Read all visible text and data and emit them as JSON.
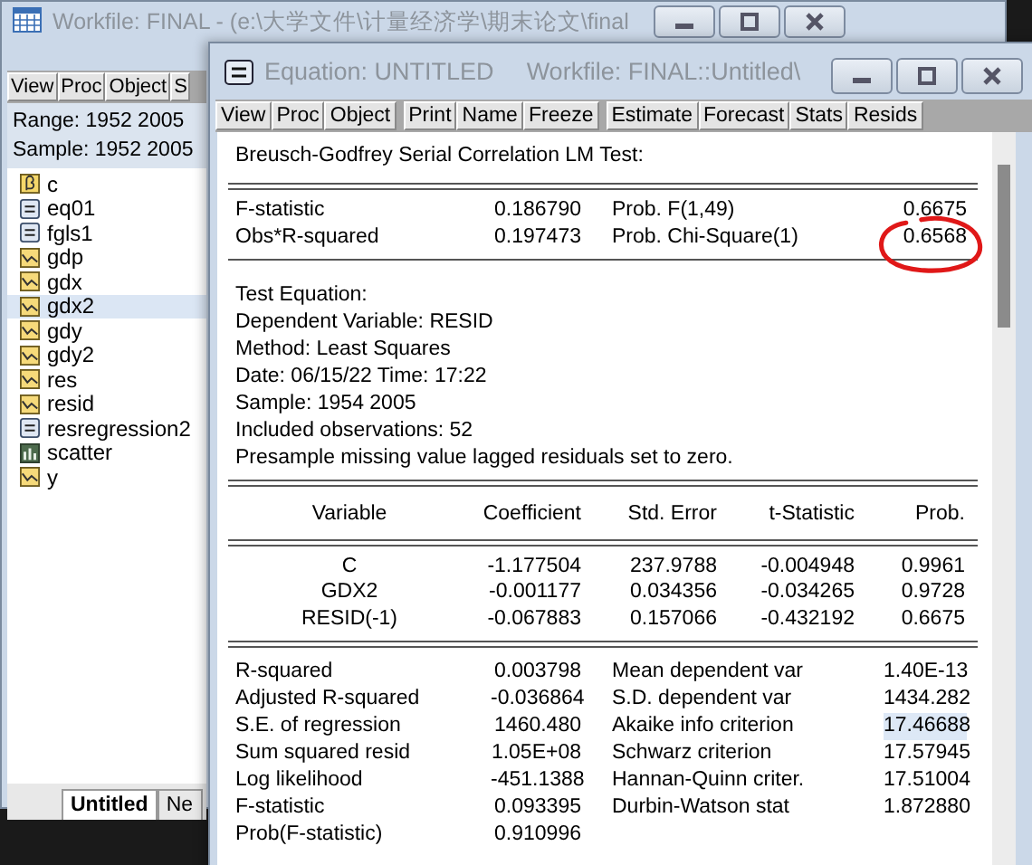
{
  "back_window": {
    "title": "Workfile: FINAL - (e:\\大学文件\\计量经济学\\期末论文\\final",
    "toolbar": [
      "View",
      "Proc",
      "Object",
      "S"
    ],
    "range": "Range:  1952 2005",
    "sample": "Sample: 1952 2005",
    "objects": [
      {
        "name": "c",
        "kind": "coef",
        "selected": false
      },
      {
        "name": "eq01",
        "kind": "equation",
        "selected": false
      },
      {
        "name": "fgls1",
        "kind": "equation",
        "selected": false
      },
      {
        "name": "gdp",
        "kind": "series",
        "selected": false
      },
      {
        "name": "gdx",
        "kind": "series",
        "selected": false
      },
      {
        "name": "gdx2",
        "kind": "series",
        "selected": true
      },
      {
        "name": "gdy",
        "kind": "series",
        "selected": false
      },
      {
        "name": "gdy2",
        "kind": "series",
        "selected": false
      },
      {
        "name": "res",
        "kind": "series",
        "selected": false
      },
      {
        "name": "resid",
        "kind": "series",
        "selected": false
      },
      {
        "name": "resregression2",
        "kind": "equation",
        "selected": false
      },
      {
        "name": "scatter",
        "kind": "graph",
        "selected": false
      },
      {
        "name": "y",
        "kind": "series",
        "selected": false
      }
    ],
    "tabs": [
      {
        "label": "Untitled",
        "selected": true
      },
      {
        "label": "Ne",
        "selected": false
      }
    ]
  },
  "front_window": {
    "title": "Equation: UNTITLED",
    "subtitle": "Workfile: FINAL::Untitled\\",
    "toolbar": [
      "View",
      "Proc",
      "Object",
      "Print",
      "Name",
      "Freeze",
      "Estimate",
      "Forecast",
      "Stats",
      "Resids"
    ],
    "heading": "Breusch-Godfrey Serial Correlation LM Test:",
    "test_stats": [
      {
        "label": "F-statistic",
        "value": "0.186790",
        "prob_label": "Prob. F(1,49)",
        "prob_value": "0.6675",
        "circled": false
      },
      {
        "label": "Obs*R-squared",
        "value": "0.197473",
        "prob_label": "Prob. Chi-Square(1)",
        "prob_value": "0.6568",
        "circled": true
      }
    ],
    "test_equation": [
      "Test Equation:",
      "Dependent Variable: RESID",
      "Method: Least Squares",
      "Date: 06/15/22   Time: 17:22",
      "Sample: 1954 2005",
      "Included observations: 52",
      "Presample missing value lagged residuals set to zero."
    ],
    "coef_table": {
      "columns": [
        "Variable",
        "Coefficient",
        "Std. Error",
        "t-Statistic",
        "Prob."
      ],
      "rows": [
        [
          "C",
          "-1.177504",
          "237.9788",
          "-0.004948",
          "0.9961"
        ],
        [
          "GDX2",
          "-0.001177",
          "0.034356",
          "-0.034265",
          "0.9728"
        ],
        [
          "RESID(-1)",
          "-0.067883",
          "0.157066",
          "-0.432192",
          "0.6675"
        ]
      ]
    },
    "summary": [
      {
        "label": "R-squared",
        "value": "0.003798",
        "label2": "Mean dependent var",
        "value2": "1.40E-13",
        "selected": false
      },
      {
        "label": "Adjusted R-squared",
        "value": "-0.036864",
        "label2": "S.D. dependent var",
        "value2": "1434.282",
        "selected": false
      },
      {
        "label": "S.E. of regression",
        "value": "1460.480",
        "label2": "Akaike info criterion",
        "value2": "17.46688",
        "selected": true
      },
      {
        "label": "Sum squared resid",
        "value": "1.05E+08",
        "label2": "Schwarz criterion",
        "value2": "17.57945",
        "selected": false
      },
      {
        "label": "Log likelihood",
        "value": "-451.1388",
        "label2": "Hannan-Quinn criter.",
        "value2": "17.51004",
        "selected": false
      },
      {
        "label": "F-statistic",
        "value": "0.093395",
        "label2": "Durbin-Watson stat",
        "value2": "1.872880",
        "selected": false
      },
      {
        "label": "Prob(F-statistic)",
        "value": "0.910996"
      }
    ]
  }
}
